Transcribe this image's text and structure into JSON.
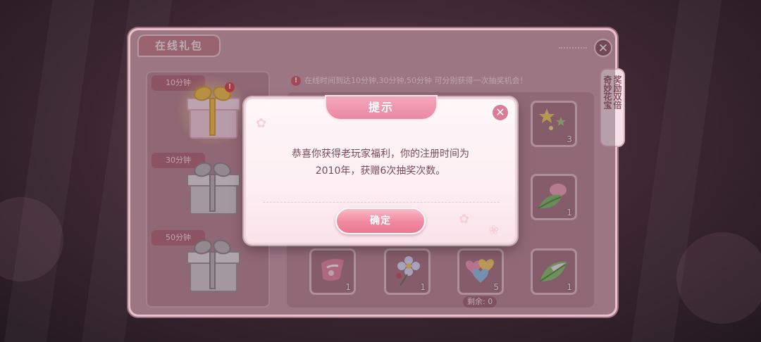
{
  "panel": {
    "title": "在线礼包",
    "close_glyph": "✕",
    "info_text": "在线时间到达10分钟,30分钟,50分钟 可分别获得一次抽奖机会！",
    "info_icon": "!",
    "side_tab": [
      "奇妙花宝",
      "奖励双倍"
    ]
  },
  "gifts": [
    {
      "label": "10分钟",
      "state": "ready",
      "badge": "!"
    },
    {
      "label": "30分钟",
      "state": "locked"
    },
    {
      "label": "50分钟",
      "state": "locked"
    }
  ],
  "rewards": {
    "top_right": {
      "icon": "stars-icon",
      "count": "3"
    },
    "mid_right": {
      "icon": "leaf-bud-icon",
      "count": "1"
    },
    "bottom": [
      {
        "icon": "ribbon-icon",
        "count": "1"
      },
      {
        "icon": "flower-icon",
        "count": "1"
      },
      {
        "icon": "hearts-balloon-icon",
        "count": "5"
      },
      {
        "icon": "green-leaf-icon",
        "count": "1"
      }
    ],
    "remaining": "剩余: 0"
  },
  "dialog": {
    "title": "提示",
    "message_line1": "恭喜你获得老玩家福利，你的注册时间为",
    "message_line2": "2010年，获赠6次抽奖次数。",
    "confirm_label": "确定",
    "close_glyph": "✕"
  },
  "colors": {
    "accent_pink": "#e98aa3",
    "panel": "#cda0ae",
    "gold_ribbon": "#f5c84b"
  }
}
